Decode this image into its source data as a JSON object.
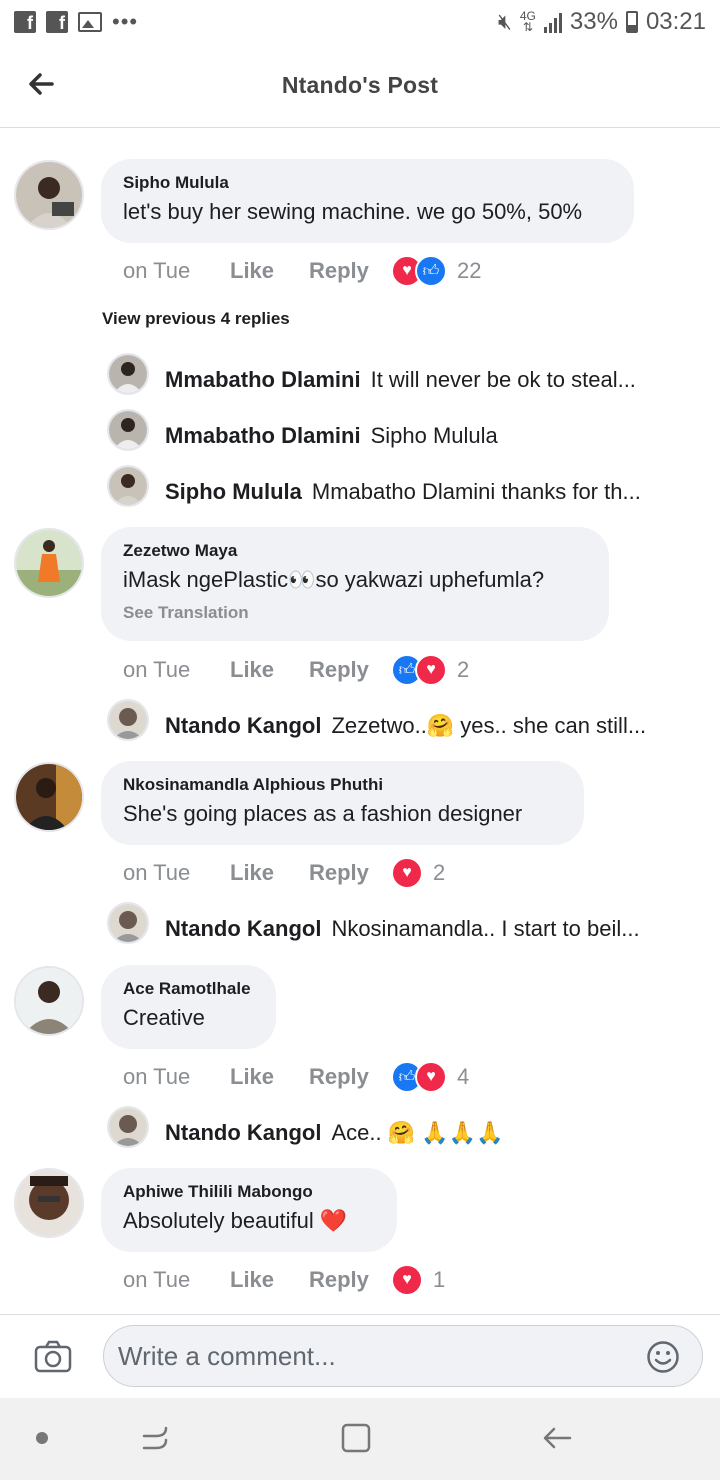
{
  "status_bar": {
    "battery": "33%",
    "time": "03:21",
    "network": "4G"
  },
  "header": {
    "title": "Ntando's Post"
  },
  "comments": [
    {
      "author": "Sipho Mulula",
      "text": "let's buy her sewing machine. we go 50%, 50%",
      "time": "on Tue",
      "like": "Like",
      "reply": "Reply",
      "reactions": [
        "heart",
        "thumb"
      ],
      "reaction_count": "22",
      "view_previous": "View previous 4 replies",
      "replies": [
        {
          "author": "Mmabatho Dlamini",
          "text": "It will never be ok to steal..."
        },
        {
          "author": "Mmabatho Dlamini",
          "text": "Sipho Mulula"
        },
        {
          "author": "Sipho Mulula",
          "text": "Mmabatho Dlamini thanks for th..."
        }
      ]
    },
    {
      "author": "Zezetwo Maya",
      "text": "iMask ngePlastic👀so yakwazi uphefumla?",
      "see_translation": "See Translation",
      "time": "on Tue",
      "like": "Like",
      "reply": "Reply",
      "reactions": [
        "thumb",
        "heart"
      ],
      "reaction_count": "2",
      "replies": [
        {
          "author": "Ntando Kangol",
          "text": "Zezetwo..🤗 yes.. she can still..."
        }
      ]
    },
    {
      "author": "Nkosinamandla Alphious Phuthi",
      "text": "She's going places as a fashion designer",
      "time": "on Tue",
      "like": "Like",
      "reply": "Reply",
      "reactions": [
        "heart"
      ],
      "reaction_count": "2",
      "replies": [
        {
          "author": "Ntando Kangol",
          "text": "Nkosinamandla.. I start to beil..."
        }
      ]
    },
    {
      "author": "Ace Ramotlhale",
      "text": "Creative",
      "time": "on Tue",
      "like": "Like",
      "reply": "Reply",
      "reactions": [
        "thumb",
        "heart"
      ],
      "reaction_count": "4",
      "replies": [
        {
          "author": "Ntando Kangol",
          "text": "Ace.. 🤗 🙏🙏🙏"
        }
      ]
    },
    {
      "author": "Aphiwe Thilili Mabongo",
      "text": "Absolutely beautiful ❤️",
      "time": "on Tue",
      "like": "Like",
      "reply": "Reply",
      "reactions": [
        "heart"
      ],
      "reaction_count": "1",
      "replies": []
    }
  ],
  "composer": {
    "placeholder": "Write a comment..."
  },
  "colors": {
    "like_blue": "#1877f2",
    "love_red": "#f02849",
    "bubble_gray": "#f0f2f5",
    "meta_gray": "#8a8d91"
  }
}
